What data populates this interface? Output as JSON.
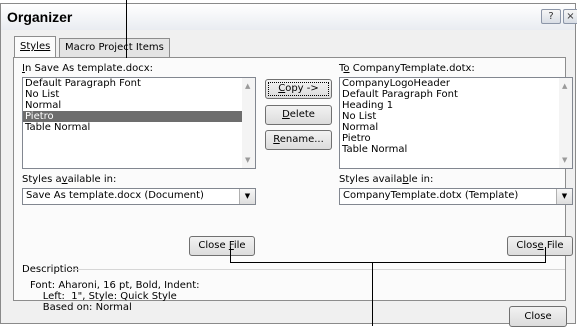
{
  "dialog": {
    "title": "Organizer",
    "help_icon": "?",
    "close_icon": "×"
  },
  "tabs": {
    "styles": "Styles",
    "macro": "Macro Project Items"
  },
  "left": {
    "label_pre": "I",
    "label_rest": "n Save As template.docx:",
    "items": [
      "Default Paragraph Font",
      "No List",
      "Normal",
      "Pietro",
      "Table Normal"
    ],
    "selected": "Pietro",
    "avail_pre": "Styles a",
    "avail_u": "v",
    "avail_post": "ailable in:",
    "combo_value": "Save As template.docx (Document)",
    "close_file_pre": "Close ",
    "close_file_u": "F",
    "close_file_post": "ile"
  },
  "center": {
    "copy_u": "C",
    "copy_post": "opy ->",
    "delete_u": "D",
    "delete_post": "elete",
    "rename_u": "R",
    "rename_post": "ename..."
  },
  "right": {
    "label_pre": "T",
    "label_u": "o",
    "label_rest": " CompanyTemplate.dotx:",
    "items": [
      "CompanyLogoHeader",
      "Default Paragraph Font",
      "Heading 1",
      "No List",
      "Normal",
      "Pietro",
      "Table Normal"
    ],
    "avail_pre": "Styles availa",
    "avail_u": "b",
    "avail_post": "le in:",
    "combo_value": "CompanyTemplate.dotx (Template)",
    "close_file_pre": "Clos",
    "close_file_u": "e",
    "close_file_post": " File"
  },
  "description": {
    "label": "Description",
    "text": "Font: Aharoni, 16 pt, Bold, Indent:\n    Left:  1\", Style: Quick Style\n    Based on: Normal"
  },
  "footer": {
    "close": "Close"
  }
}
